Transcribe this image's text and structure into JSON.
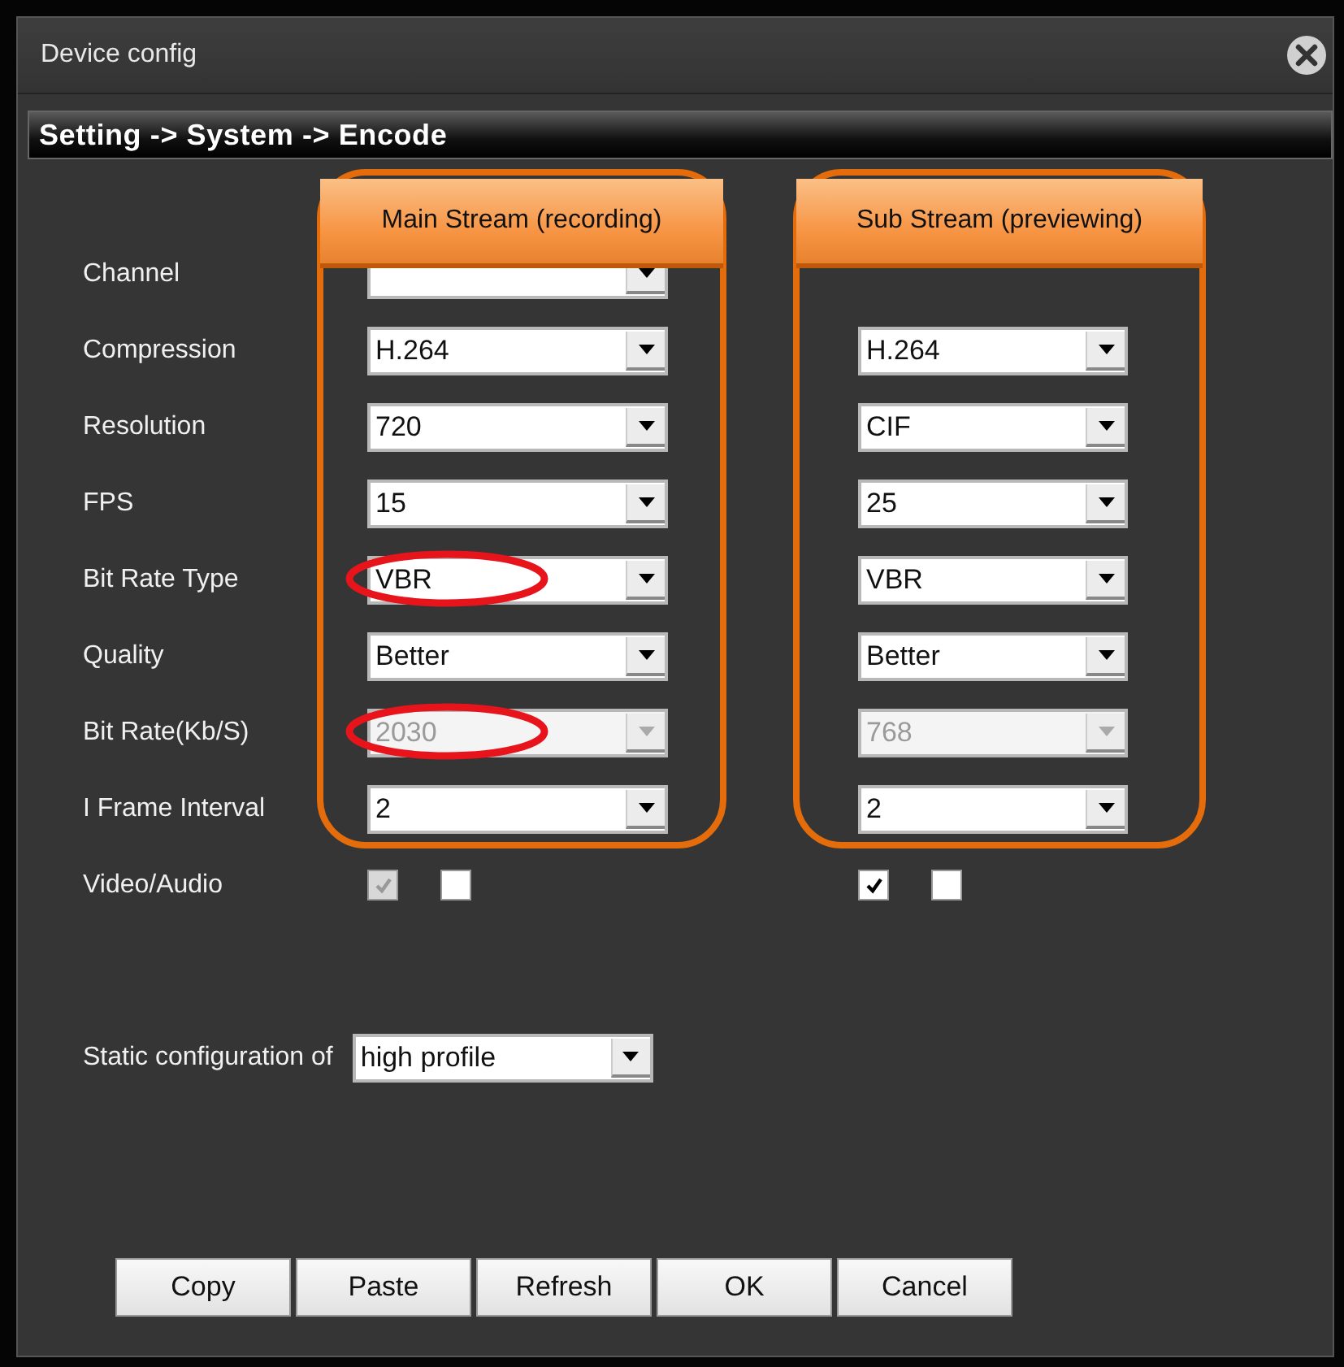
{
  "window": {
    "title": "Device config"
  },
  "breadcrumb": "Setting -> System -> Encode",
  "streams": [
    {
      "title": "Main Stream (recording)"
    },
    {
      "title": "Sub Stream (previewing)"
    }
  ],
  "rows": [
    {
      "kind": "dropdown",
      "label": "Channel",
      "main": {
        "disabled": false,
        "highlighted": false
      },
      "sub": null
    },
    {
      "kind": "dropdown",
      "label": "Compression",
      "main": {
        "value": "H.264",
        "disabled": false,
        "highlighted": false
      },
      "sub": {
        "value": "H.264",
        "disabled": false,
        "highlighted": false
      }
    },
    {
      "kind": "dropdown",
      "label": "Resolution",
      "main": {
        "value": "720",
        "disabled": false,
        "highlighted": false
      },
      "sub": {
        "value": "CIF",
        "disabled": false,
        "highlighted": false
      }
    },
    {
      "kind": "dropdown",
      "label": "FPS",
      "main": {
        "value": "15",
        "disabled": false,
        "highlighted": false
      },
      "sub": {
        "value": "25",
        "disabled": false,
        "highlighted": false
      }
    },
    {
      "kind": "dropdown",
      "label": "Bit Rate Type",
      "main": {
        "value": "VBR",
        "disabled": false,
        "highlighted": true
      },
      "sub": {
        "value": "VBR",
        "disabled": false,
        "highlighted": false
      }
    },
    {
      "kind": "dropdown",
      "label": "Quality",
      "main": {
        "value": "Better",
        "disabled": false,
        "highlighted": false
      },
      "sub": {
        "value": "Better",
        "disabled": false,
        "highlighted": false
      }
    },
    {
      "kind": "dropdown",
      "label": "Bit Rate(Kb/S)",
      "main": {
        "value": "2030",
        "disabled": true,
        "highlighted": true
      },
      "sub": {
        "value": "768",
        "disabled": true,
        "highlighted": false
      }
    },
    {
      "kind": "dropdown",
      "label": "I Frame Interval",
      "main": {
        "value": "2",
        "disabled": false,
        "highlighted": false
      },
      "sub": {
        "value": "2",
        "disabled": false,
        "highlighted": false
      }
    },
    {
      "kind": "checkboxes",
      "label": "Video/Audio",
      "main": {
        "video": {
          "checked": true,
          "disabled": true
        },
        "audio": {
          "checked": false,
          "disabled": false
        }
      },
      "sub": {
        "video": {
          "checked": true,
          "disabled": false
        },
        "audio": {
          "checked": false,
          "disabled": false
        }
      }
    }
  ],
  "static_config": {
    "label": "Static configuration of",
    "value": "high profile"
  },
  "buttons": [
    "Copy",
    "Paste",
    "Refresh",
    "OK",
    "Cancel"
  ]
}
